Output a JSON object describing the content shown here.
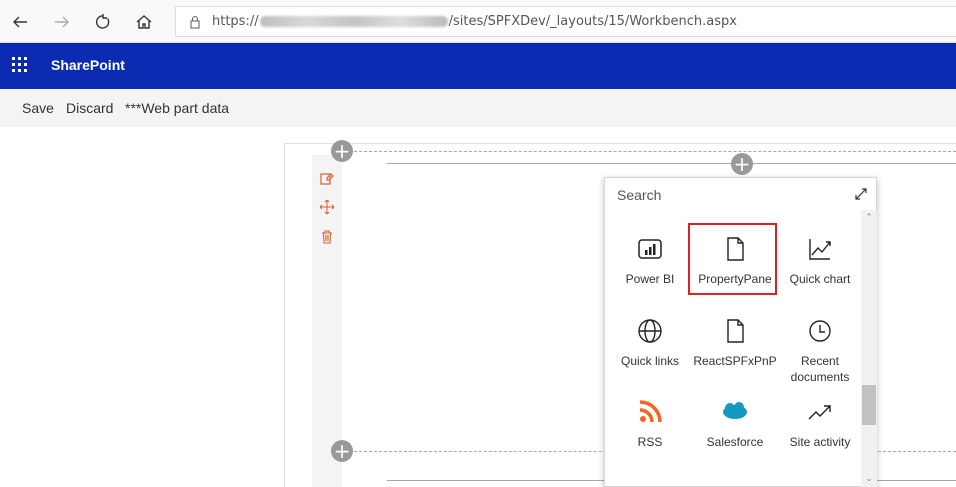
{
  "browser": {
    "url_prefix": "https://",
    "url_suffix": "/sites/SPFXDev/_layouts/15/Workbench.aspx",
    "back_icon": "back-arrow-icon",
    "forward_icon": "forward-arrow-icon",
    "refresh_icon": "refresh-icon",
    "home_icon": "home-icon",
    "lock_icon": "lock-icon"
  },
  "suite_bar": {
    "title": "SharePoint",
    "waffle_icon": "app-launcher-icon"
  },
  "command_bar": {
    "save": "Save",
    "discard": "Discard",
    "web_part_data": "***Web part data"
  },
  "toolbox": {
    "search_placeholder": "Search",
    "items": [
      {
        "label": "Power BI",
        "icon": "power-bi-icon"
      },
      {
        "label": "PropertyPane",
        "icon": "page-icon",
        "highlighted": true
      },
      {
        "label": "Quick chart",
        "icon": "chart-icon"
      },
      {
        "label": "Quick links",
        "icon": "globe-icon"
      },
      {
        "label": "ReactSPFxPnP",
        "icon": "page-icon"
      },
      {
        "label": "Recent documents",
        "icon": "clock-icon"
      },
      {
        "label": "RSS",
        "icon": "rss-icon"
      },
      {
        "label": "Salesforce",
        "icon": "salesforce-cloud-icon"
      },
      {
        "label": "Site activity",
        "icon": "trend-icon"
      }
    ]
  },
  "colors": {
    "suite_bar": "#0b2bb2",
    "highlight": "#e02020",
    "accent_orange": "#d9602a"
  }
}
